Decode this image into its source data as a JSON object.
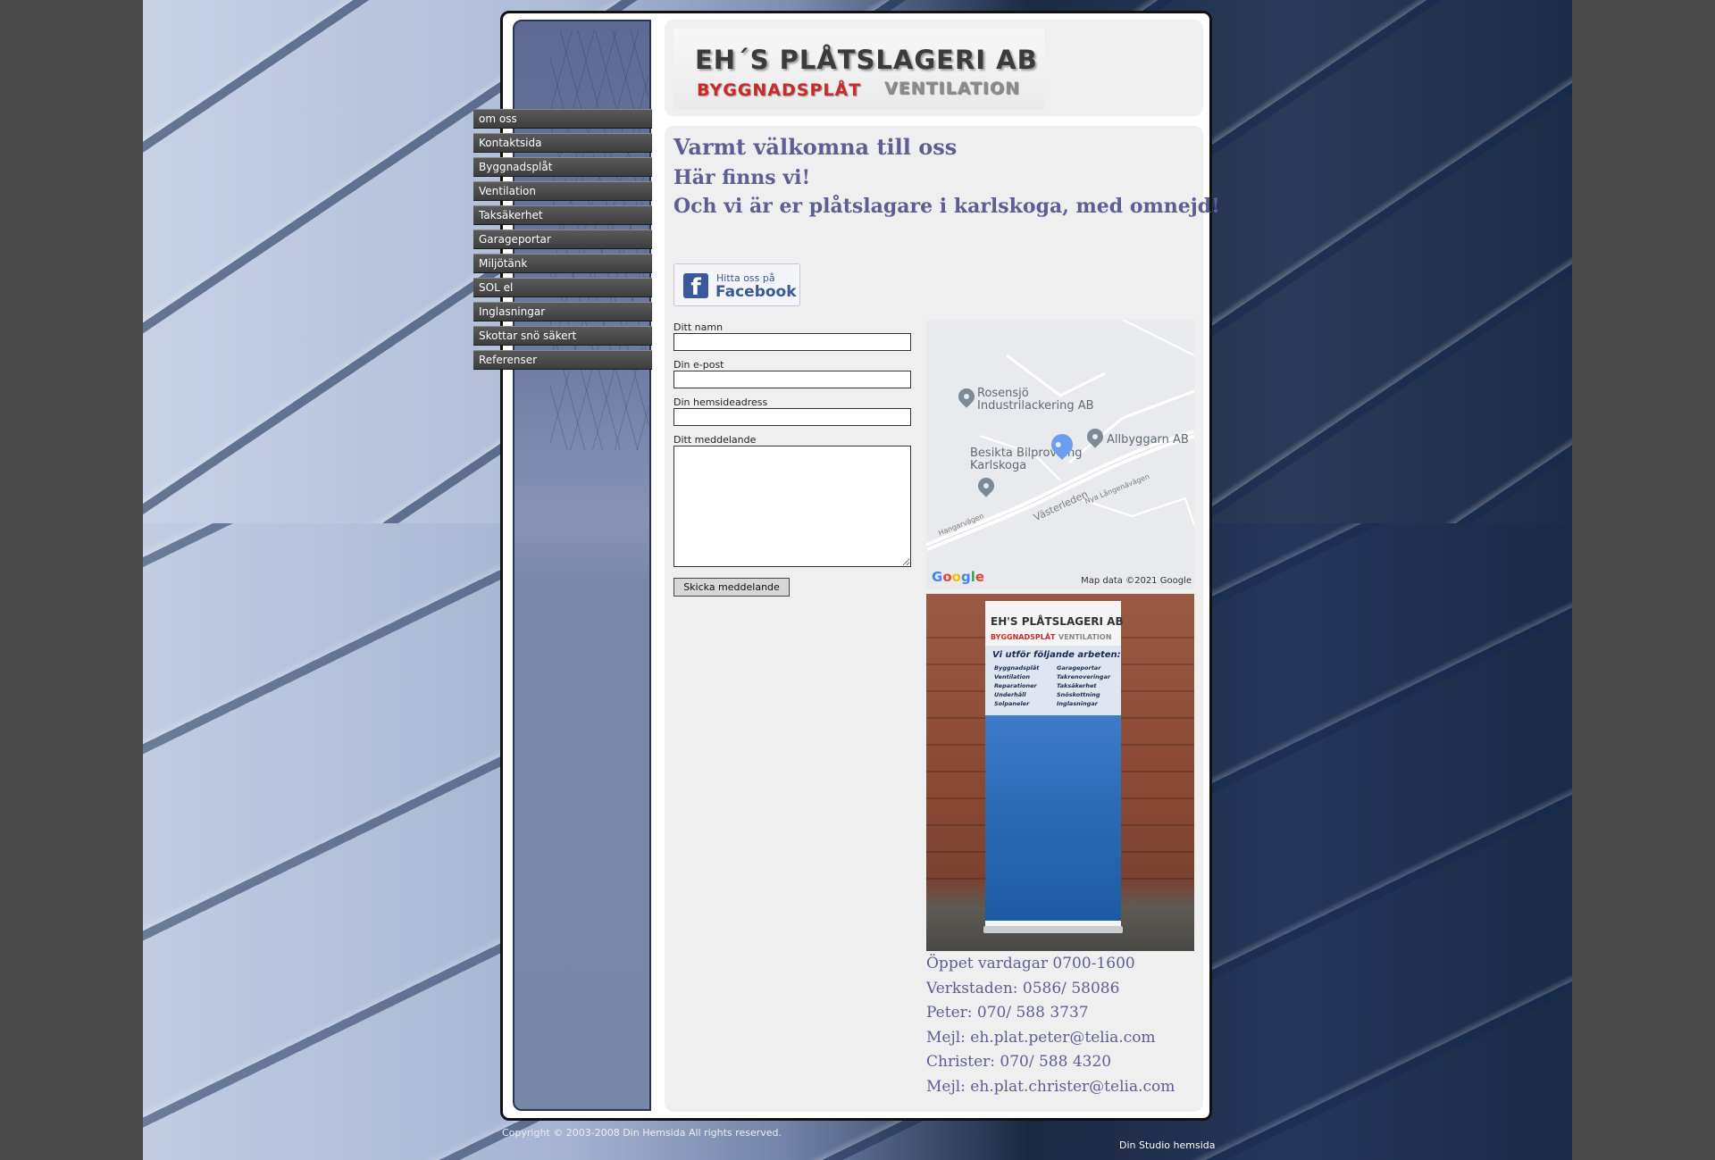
{
  "logo": {
    "title": "EH´S PLÅTSLAGERI AB",
    "sub_red": "BYGGNADSPLÅT",
    "sub_grey": "VENTILATION"
  },
  "menu": [
    "om oss",
    "Kontaktsida",
    "Byggnadsplåt",
    "Ventilation",
    "Taksäkerhet",
    "Garageportar",
    "Miljötänk",
    "SOL el",
    "Inglasningar",
    "Skottar snö säkert",
    "Referenser"
  ],
  "content": {
    "heading1": "Varmt välkomna till oss",
    "heading2": "Här finns vi!",
    "heading3": "Och vi är er plåtslagare i karlskoga, med omnejd!"
  },
  "facebook": {
    "line1": "Hitta oss på",
    "line2": "Facebook"
  },
  "form": {
    "name_label": "Ditt namn",
    "email_label": "Din e-post",
    "website_label": "Din hemsideadress",
    "message_label": "Ditt meddelande",
    "name_value": "",
    "email_value": "",
    "website_value": "",
    "message_value": "",
    "submit_label": "Skicka meddelande"
  },
  "map": {
    "labels": {
      "rosensjo": "Rosensjö\nIndustrilackering AB",
      "allbyggarn": "Allbyggarn AB",
      "besikta": "Besikta Bilprovning\nKarlskoga"
    },
    "roads": {
      "vasterleden": "Västerleden",
      "langen": "Nya Långenävägen",
      "hangar": "Hangarvägen"
    },
    "google": "Google",
    "credit": "Map data ©2021 Google",
    "colors": {
      "pin": "#7b8a96",
      "selected_pin": "#6c9ef0"
    }
  },
  "photo": {
    "banner_title": "EH'S PLÅTSLAGERI AB",
    "banner_sub_red": "BYGGNADSPLÅT",
    "banner_sub_grey": "VENTILATION",
    "banner_heading": "Vi utför följande arbeten:",
    "banner_list_left": [
      "Byggnadsplåt",
      "Ventilation",
      "Reparationer",
      "Underhåll",
      "Solpaneler"
    ],
    "banner_list_right": [
      "Garageportar",
      "Takrenoveringar",
      "Taksäkerhet",
      "Snöskottning",
      "Inglasningar"
    ]
  },
  "contact": [
    "Öppet vardagar 0700-1600",
    "Verkstaden: 0586/ 58086",
    "Peter: 070/ 588 3737",
    "Mejl: eh.plat.peter@telia.com",
    "Christer: 070/ 588 4320",
    "Mejl: eh.plat.christer@telia.com"
  ],
  "footer": {
    "copyright": "Copyright © 2003-2008 Din Hemsida All rights reserved.",
    "studio": "Din Studio hemsida"
  },
  "colors": {
    "heading": "#5d5e93",
    "menu_bg": "#4a4a4a",
    "facebook": "#3b5998",
    "logo_red": "#cc2a2a"
  }
}
